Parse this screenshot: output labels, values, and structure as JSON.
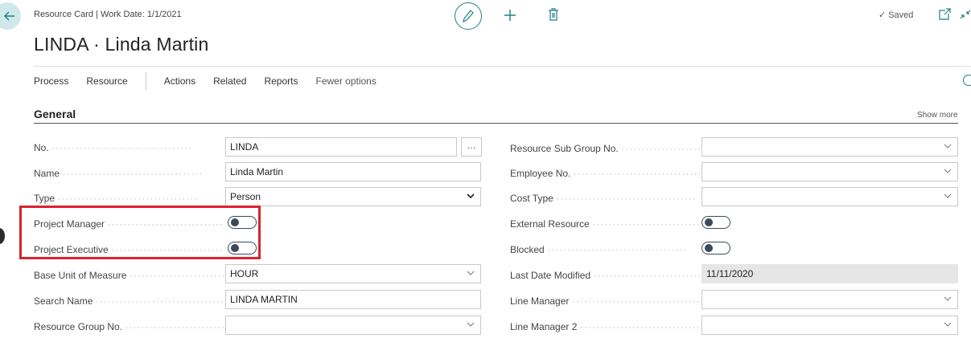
{
  "header": {
    "breadcrumb": "Resource Card | Work Date: 1/1/2021",
    "title": "LINDA · Linda Martin",
    "saved_label": "Saved",
    "icons": [
      "back-arrow-icon",
      "pencil-icon",
      "plus-icon",
      "trash-icon",
      "checkmark-icon",
      "popout-icon",
      "collapse-icon"
    ]
  },
  "actionbar": {
    "items": [
      "Process",
      "Resource",
      "Actions",
      "Related",
      "Reports",
      "Fewer options"
    ]
  },
  "section": {
    "title": "General",
    "show_more": "Show more"
  },
  "fields_left": [
    {
      "label": "No.",
      "value": "LINDA",
      "kind": "text-lookup"
    },
    {
      "label": "Name",
      "value": "Linda Martin",
      "kind": "text"
    },
    {
      "label": "Type",
      "value": "Person",
      "kind": "select"
    },
    {
      "label": "Project Manager",
      "value": "off",
      "kind": "toggle"
    },
    {
      "label": "Project Executive",
      "value": "off",
      "kind": "toggle"
    },
    {
      "label": "Base Unit of Measure",
      "value": "HOUR",
      "kind": "select"
    },
    {
      "label": "Search Name",
      "value": "LINDA MARTIN",
      "kind": "text"
    },
    {
      "label": "Resource Group No.",
      "value": "",
      "kind": "select"
    }
  ],
  "fields_right": [
    {
      "label": "Resource Sub Group No.",
      "value": "",
      "kind": "select"
    },
    {
      "label": "Employee No.",
      "value": "",
      "kind": "select"
    },
    {
      "label": "Cost Type",
      "value": "",
      "kind": "select"
    },
    {
      "label": "External Resource",
      "value": "off",
      "kind": "toggle"
    },
    {
      "label": "Blocked",
      "value": "off",
      "kind": "toggle"
    },
    {
      "label": "Last Date Modified",
      "value": "11/11/2020",
      "kind": "readonly"
    },
    {
      "label": "Line Manager",
      "value": "",
      "kind": "select"
    },
    {
      "label": "Line Manager 2",
      "value": "",
      "kind": "select"
    }
  ],
  "lookup_button": "…",
  "colors": {
    "accent": "#1d7f83",
    "highlight": "#d9232e",
    "back_button_bg": "#cfe9ea"
  }
}
